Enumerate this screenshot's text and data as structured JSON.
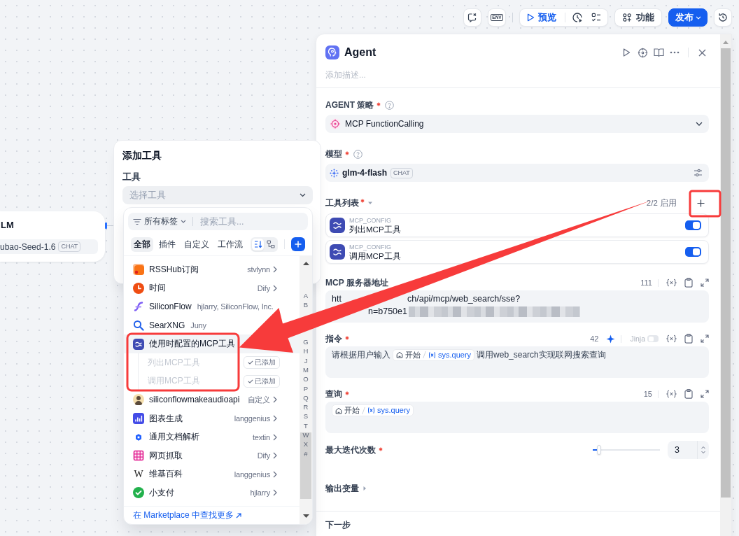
{
  "toolbar": {
    "env_label": "ENV",
    "preview_label": "预览",
    "features_label": "功能",
    "publish_label": "发布"
  },
  "canvas_node": {
    "title": "LM",
    "model": "ubao-Seed-1.6",
    "badge": "CHAT"
  },
  "add_tool_popup": {
    "title": "添加工具",
    "field_label": "工具",
    "select_placeholder": "选择工具"
  },
  "tool_picker": {
    "filter_label": "所有标签",
    "search_placeholder": "搜索工具...",
    "tabs": [
      {
        "label": "全部",
        "selected": true
      },
      {
        "label": "插件",
        "selected": false
      },
      {
        "label": "自定义",
        "selected": false
      },
      {
        "label": "工作流",
        "selected": false
      }
    ],
    "view_modes": [
      {
        "kind": "alphabetical",
        "selected": true
      },
      {
        "kind": "tree",
        "selected": false
      }
    ],
    "tools": [
      {
        "name": "RSSHub订阅",
        "author": "stvlynn",
        "chevron": true,
        "hovered": false
      },
      {
        "name": "时间",
        "author": "Dify",
        "chevron": true,
        "hovered": false
      },
      {
        "name": "SiliconFlow",
        "author": "hjlarry, SiliconFlow, Inc.",
        "chevron": false,
        "hovered": false
      },
      {
        "name": "SearXNG",
        "author": "Juny",
        "chevron": false,
        "hovered": false
      },
      {
        "name": "使用时配置的MCP工具",
        "hovered": true,
        "expanded": true,
        "children": [
          {
            "name": "列出MCP工具",
            "added": true,
            "badge": "已添加"
          },
          {
            "name": "调用MCP工具",
            "added": true,
            "badge": "已添加"
          }
        ]
      },
      {
        "name": "siliconflowmakeaudioapi",
        "author": "自定义",
        "chevron": true,
        "hovered": false
      },
      {
        "name": "图表生成",
        "author": "langgenius",
        "chevron": true,
        "hovered": false
      },
      {
        "name": "通用文档解析",
        "author": "textin",
        "chevron": true,
        "hovered": false
      },
      {
        "name": "网页抓取",
        "author": "Dify",
        "chevron": true,
        "hovered": false
      },
      {
        "name": "维基百科",
        "author": "langgenius",
        "glyph": "W",
        "chevron": true,
        "hovered": false
      },
      {
        "name": "小支付",
        "author": "hjlarry",
        "chevron": true,
        "hovered": false
      }
    ],
    "index_groups": [
      [
        "A",
        "B"
      ],
      [
        "G",
        "H",
        "J",
        "M",
        "O",
        "P",
        "Q",
        "R",
        "S",
        "T",
        "W",
        "X",
        "#"
      ]
    ],
    "footer_link": "在 Marketplace 中查找更多"
  },
  "agent_panel": {
    "title": "Agent",
    "description_placeholder": "添加描述...",
    "strategy": {
      "label": "AGENT 策略",
      "required": true,
      "value": "MCP FunctionCalling"
    },
    "model": {
      "label": "模型",
      "required": true,
      "name": "glm-4-flash",
      "badge": "CHAT"
    },
    "tool_list": {
      "label": "工具列表",
      "required": true,
      "expanded": true,
      "enabled_count": "2/2 启用",
      "tools": [
        {
          "provider": "MCP_CONFIG",
          "name": "列出MCP工具",
          "enabled": true
        },
        {
          "provider": "MCP_CONFIG",
          "name": "调用MCP工具",
          "enabled": true
        }
      ]
    },
    "server_url": {
      "label": "MCP 服务器地址",
      "char_count": "111",
      "fragments": [
        "htt",
        "ch/api/mcp/web_search/sse?",
        "n=b750e1"
      ]
    },
    "instruction": {
      "label": "指令",
      "required": true,
      "char_count": "42",
      "jinja_label": "Jinja",
      "jinja_enabled": false,
      "text_before": "请根据用户输入",
      "variable": {
        "node": "开始",
        "name": "sys.query"
      },
      "text_after": "调用web_search实现联网搜索查询"
    },
    "query": {
      "label": "查询",
      "required": true,
      "char_count": "15",
      "variable": {
        "node": "开始",
        "name": "sys.query"
      }
    },
    "max_iterations": {
      "label": "最大迭代次数",
      "required": true,
      "level": 0.09,
      "value": "3"
    },
    "output_variables": {
      "label": "输出变量",
      "expanded": false
    },
    "next_step": {
      "label": "下一步"
    }
  }
}
